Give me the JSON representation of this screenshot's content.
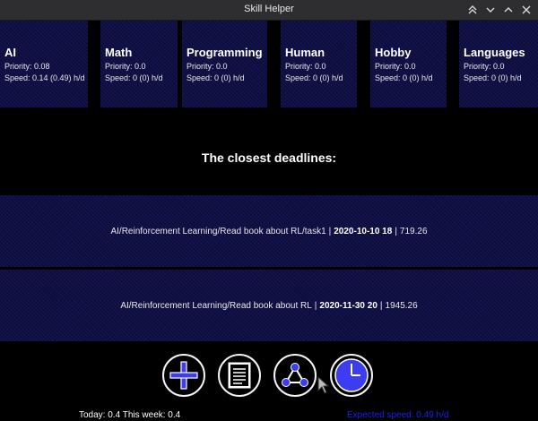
{
  "window": {
    "title": "Skill Helper"
  },
  "skills": [
    {
      "name": "AI",
      "priority": "Priority: 0.08",
      "speed": "Speed: 0.14 (0.49) h/d"
    },
    {
      "name": "Math",
      "priority": "Priority: 0.0",
      "speed": "Speed: 0 (0) h/d"
    },
    {
      "name": "Programming",
      "priority": "Priority: 0.0",
      "speed": "Speed: 0 (0) h/d"
    },
    {
      "name": "Human",
      "priority": "Priority: 0.0",
      "speed": "Speed: 0 (0) h/d"
    },
    {
      "name": "Hobby",
      "priority": "Priority: 0.0",
      "speed": "Speed: 0 (0) h/d"
    },
    {
      "name": "Languages",
      "priority": "Priority: 0.0",
      "speed": "Speed: 0 (0) h/d"
    }
  ],
  "deadlines_heading": "The closest deadlines:",
  "deadlines": [
    {
      "path": "AI/Reinforcement Learning/Read book about RL/task1",
      "sep1": "|",
      "date": "2020-10-10 18",
      "sep2": "|",
      "value": "719.26"
    },
    {
      "path": "AI/Reinforcement Learning/Read book about RL",
      "sep1": "|",
      "date": "2020-11-30 20",
      "sep2": "|",
      "value": "1945.26"
    }
  ],
  "actions": [
    {
      "icon": "plus-icon"
    },
    {
      "icon": "document-icon"
    },
    {
      "icon": "graph-icon"
    },
    {
      "icon": "clock-icon"
    }
  ],
  "footer": {
    "stats": "Today: 0.4 This week: 0.4",
    "expected": "Expected speed: 0.49 h/d"
  },
  "colors": {
    "tile_bg": "#0f0f48",
    "accent_blue": "#3c3cf0",
    "expected_text": "#1e1ef0"
  }
}
